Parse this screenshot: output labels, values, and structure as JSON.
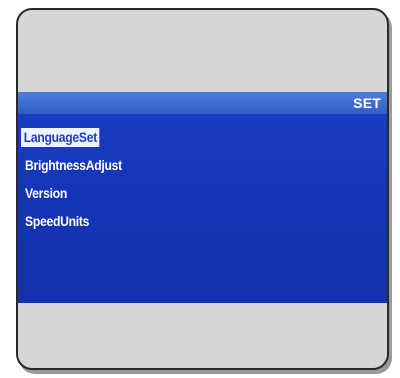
{
  "screen": {
    "title": "SET",
    "menu": [
      {
        "label": "LanguageSet",
        "selected": true
      },
      {
        "label": "BrightnessAdjust",
        "selected": false
      },
      {
        "label": "Version",
        "selected": false
      },
      {
        "label": "SpeedUnits",
        "selected": false
      }
    ]
  },
  "colors": {
    "screen_background": "#1534b5",
    "header_bar": "#2f5dc7",
    "selection_highlight": "#eef2ff",
    "device_bezel": "#d6d6d6"
  }
}
